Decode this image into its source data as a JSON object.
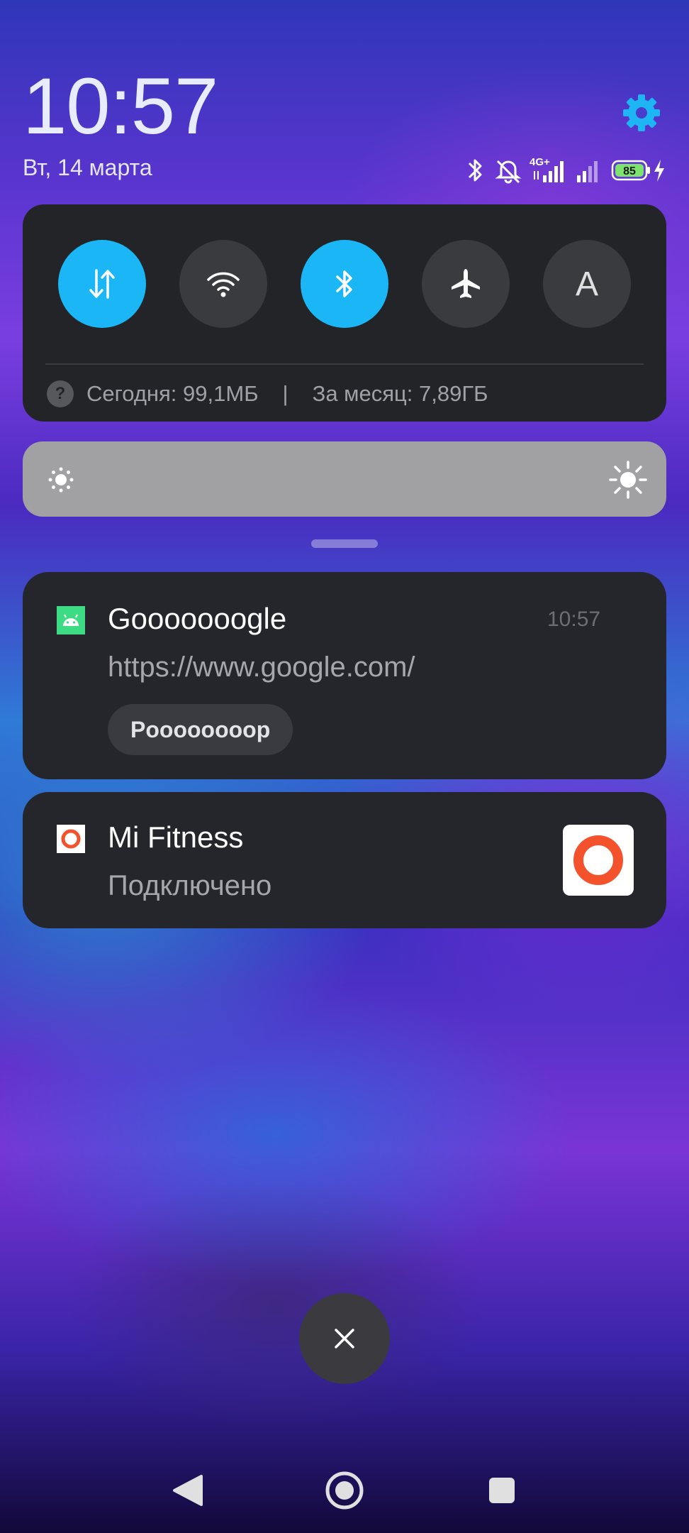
{
  "clock": {
    "time": "10:57",
    "date": "Вт, 14 марта"
  },
  "status_bar": {
    "icons": [
      "bluetooth-icon",
      "silent-bell-icon",
      "4g-icon",
      "signal-icon",
      "signal-icon-2",
      "battery-icon",
      "charging-icon"
    ],
    "network": "4G+",
    "battery_level": "85"
  },
  "quick_settings": {
    "toggles": [
      {
        "name": "mobile-data",
        "icon": "data-arrows-icon",
        "active": true
      },
      {
        "name": "wifi",
        "icon": "wifi-icon",
        "active": false
      },
      {
        "name": "bluetooth",
        "icon": "bluetooth-icon",
        "active": true
      },
      {
        "name": "airplane-mode",
        "icon": "airplane-icon",
        "active": false
      },
      {
        "name": "auto-brightness",
        "icon": "auto-brightness-icon",
        "label": "A",
        "active": false
      }
    ],
    "usage": {
      "help": "?",
      "today": "Сегодня: 99,1МБ",
      "separator": "|",
      "month": "За месяц: 7,89ГБ"
    }
  },
  "brightness": {
    "min_icon": "sun-small-icon",
    "max_icon": "sun-large-icon"
  },
  "notifications": [
    {
      "app": "Gooooooogle",
      "text": "https://www.google.com/",
      "time": "10:57",
      "action": "Poooooooop",
      "icon": "android-icon"
    },
    {
      "app": "Mi Fitness",
      "text": "Подключено",
      "icon": "mi-fitness-icon"
    }
  ],
  "colors": {
    "accent": "#1ab6f5",
    "panel": "#232427",
    "notification": "#25262b",
    "mi_fitness": "#f4522d"
  },
  "close_button": {
    "icon": "close-icon"
  },
  "nav_bar": {
    "back": "back-icon",
    "home": "home-icon",
    "recents": "recents-icon"
  }
}
